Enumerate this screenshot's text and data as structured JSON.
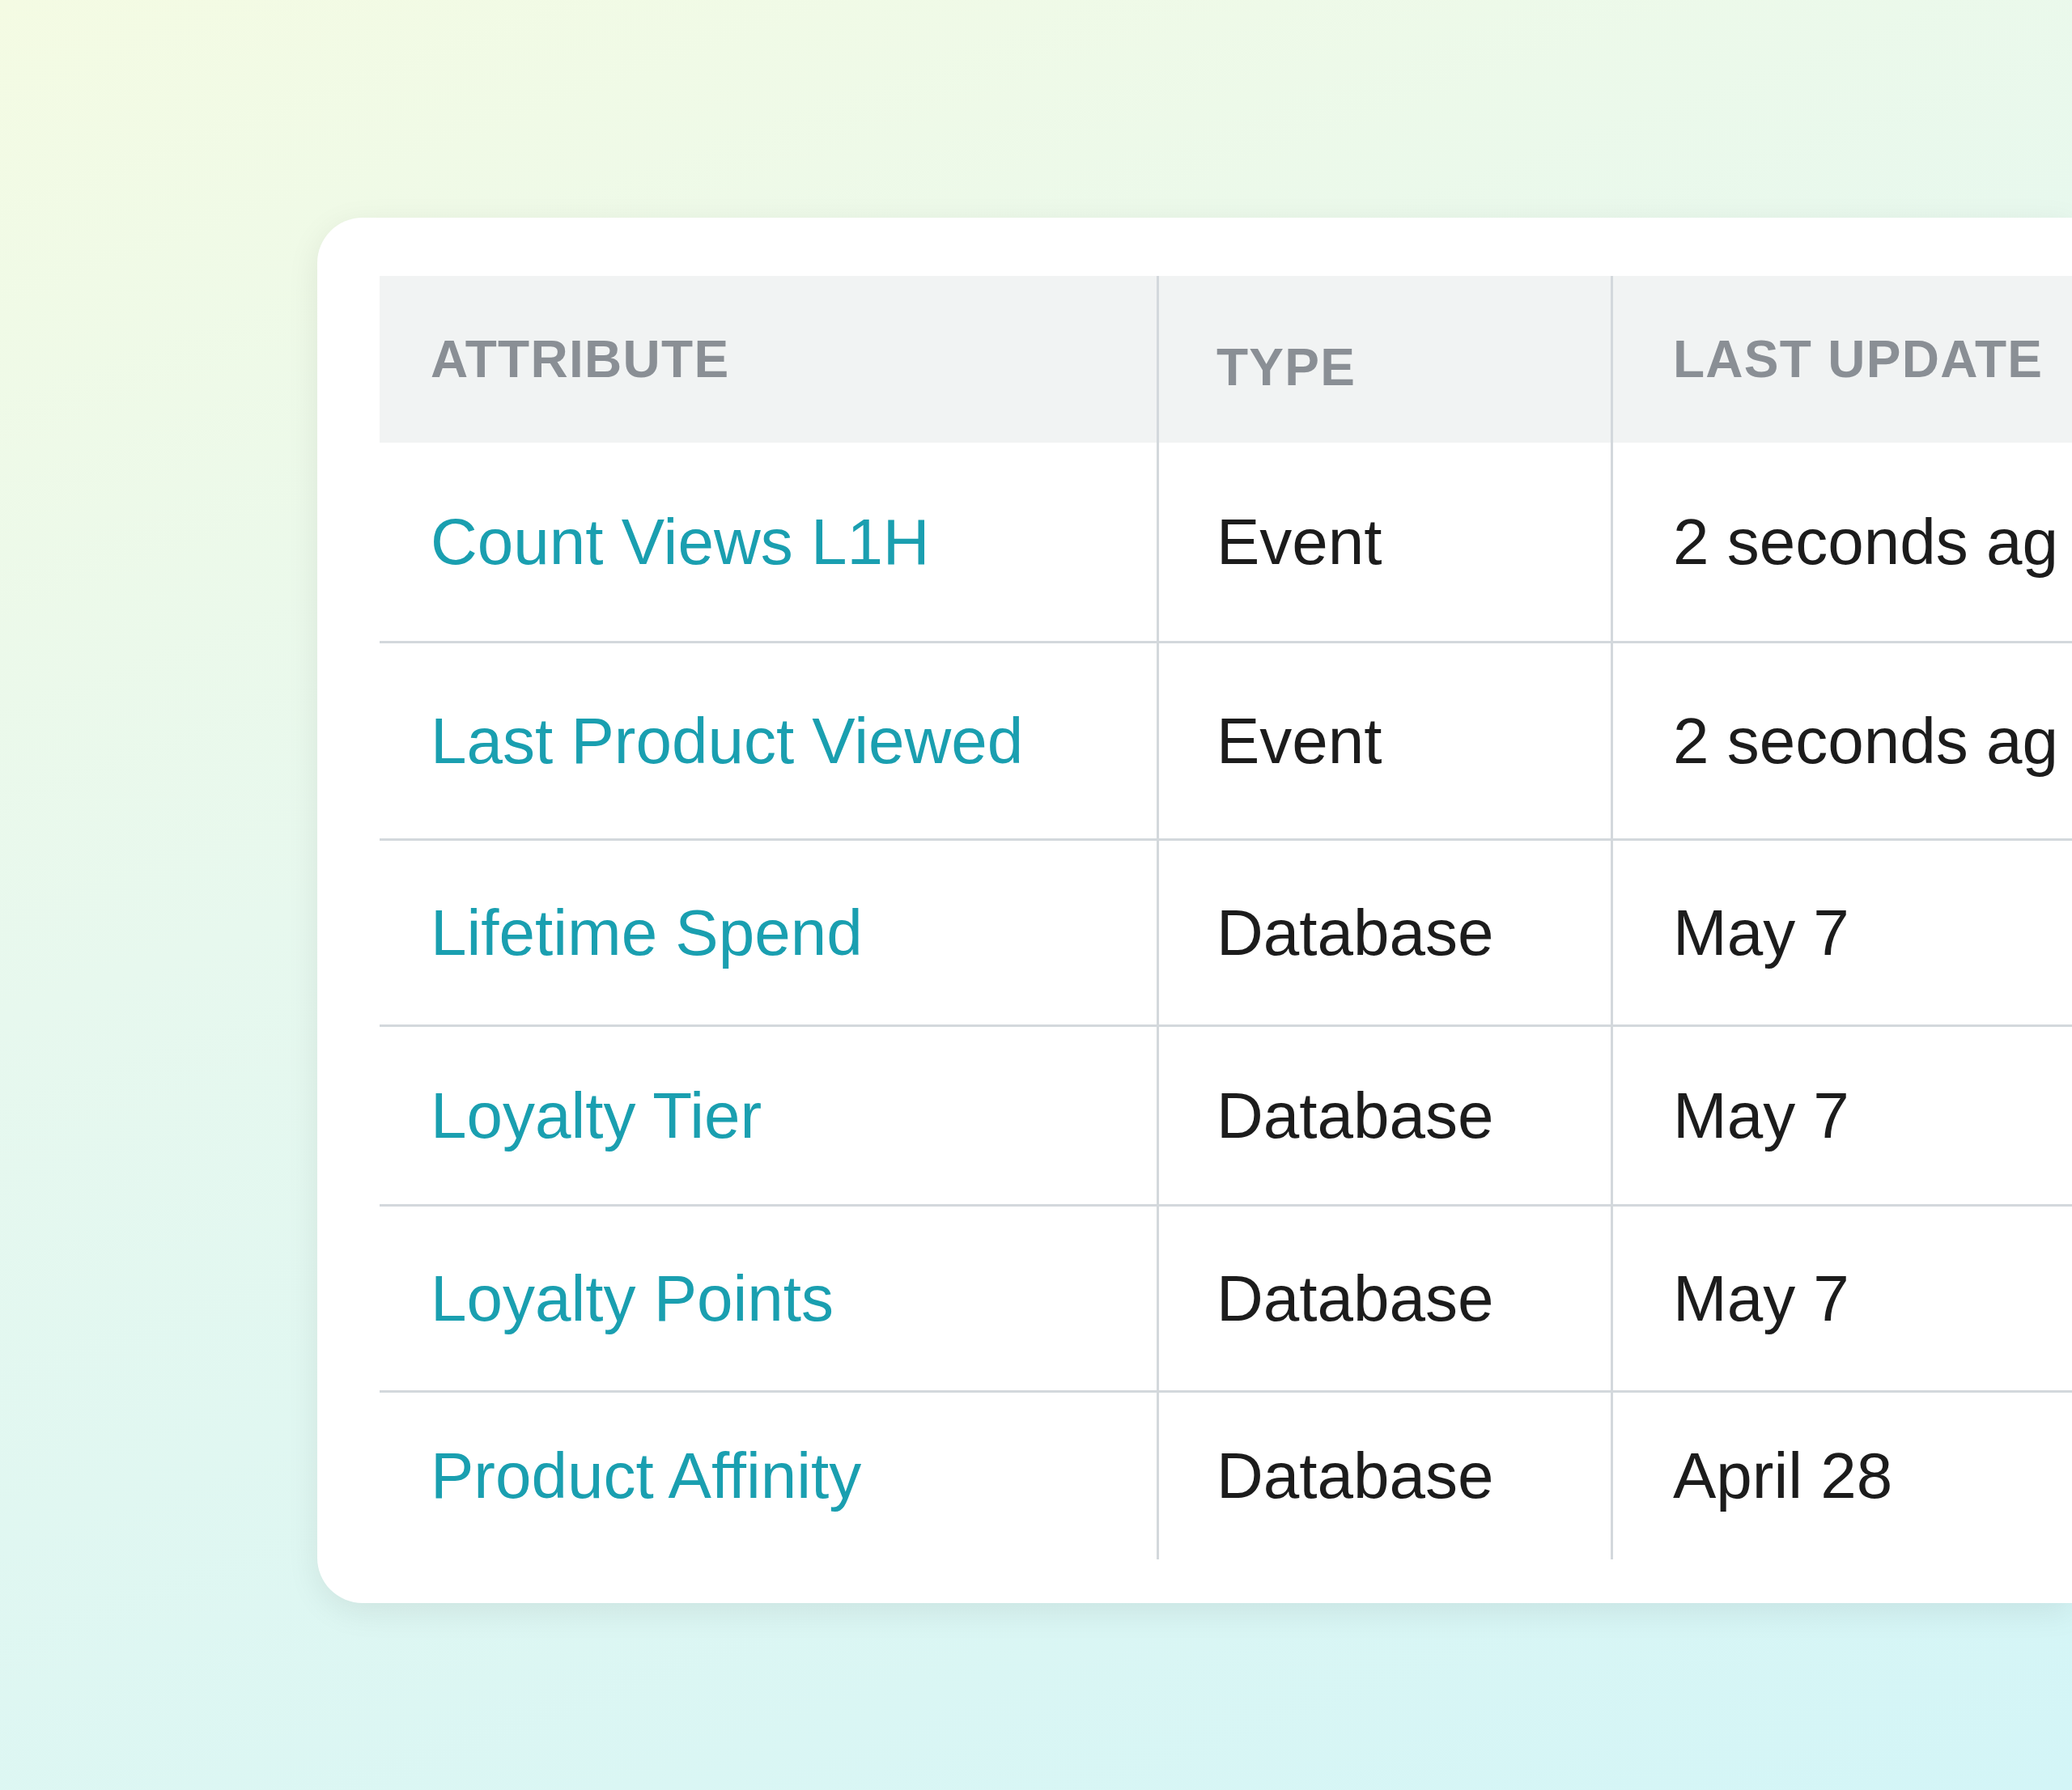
{
  "table": {
    "columns": [
      {
        "label": "ATTRIBUTE"
      },
      {
        "label": "TYPE"
      },
      {
        "label": "LAST UPDATE"
      }
    ],
    "rows": [
      {
        "attribute": "Count Views L1H",
        "type": "Event",
        "last_updated": "2 seconds ag"
      },
      {
        "attribute": "Last Product Viewed",
        "type": "Event",
        "last_updated": "2 seconds ag"
      },
      {
        "attribute": "Lifetime Spend",
        "type": "Database",
        "last_updated": "May 7"
      },
      {
        "attribute": "Loyalty Tier",
        "type": "Database",
        "last_updated": "May 7"
      },
      {
        "attribute": "Loyalty Points",
        "type": "Database",
        "last_updated": "May 7"
      },
      {
        "attribute": "Product Affinity",
        "type": "Database",
        "last_updated": "April 28"
      }
    ]
  }
}
